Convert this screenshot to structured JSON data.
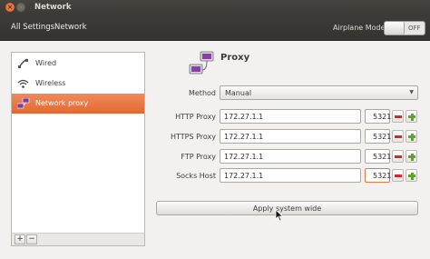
{
  "window": {
    "title": "Network"
  },
  "titlebar": {
    "close_glyph": "×"
  },
  "toolbar": {
    "breadcrumbs": [
      "All Settings",
      "Network"
    ],
    "airplane_mode_label": "Airplane Mode",
    "airplane_mode_state": "OFF"
  },
  "sidebar": {
    "items": [
      {
        "label": "Wired",
        "icon": "wired-icon",
        "selected": false
      },
      {
        "label": "Wireless",
        "icon": "wireless-icon",
        "selected": false
      },
      {
        "label": "Network proxy",
        "icon": "network-proxy-icon",
        "selected": true
      }
    ],
    "add_label": "+",
    "remove_label": "−"
  },
  "main": {
    "heading": "Proxy",
    "method": {
      "label": "Method",
      "value": "Manual"
    },
    "rows": [
      {
        "label": "HTTP Proxy",
        "host": "172.27.1.1",
        "port": "5321"
      },
      {
        "label": "HTTPS Proxy",
        "host": "172.27.1.1",
        "port": "5321"
      },
      {
        "label": "FTP Proxy",
        "host": "172.27.1.1",
        "port": "5321"
      },
      {
        "label": "Socks Host",
        "host": "172.27.1.1",
        "port": "5321"
      }
    ],
    "apply_label": "Apply system wide"
  },
  "colors": {
    "accent": "#e2692f",
    "titlebar": "#3c3b37",
    "remove": "#d7262b",
    "add": "#5aa821"
  }
}
